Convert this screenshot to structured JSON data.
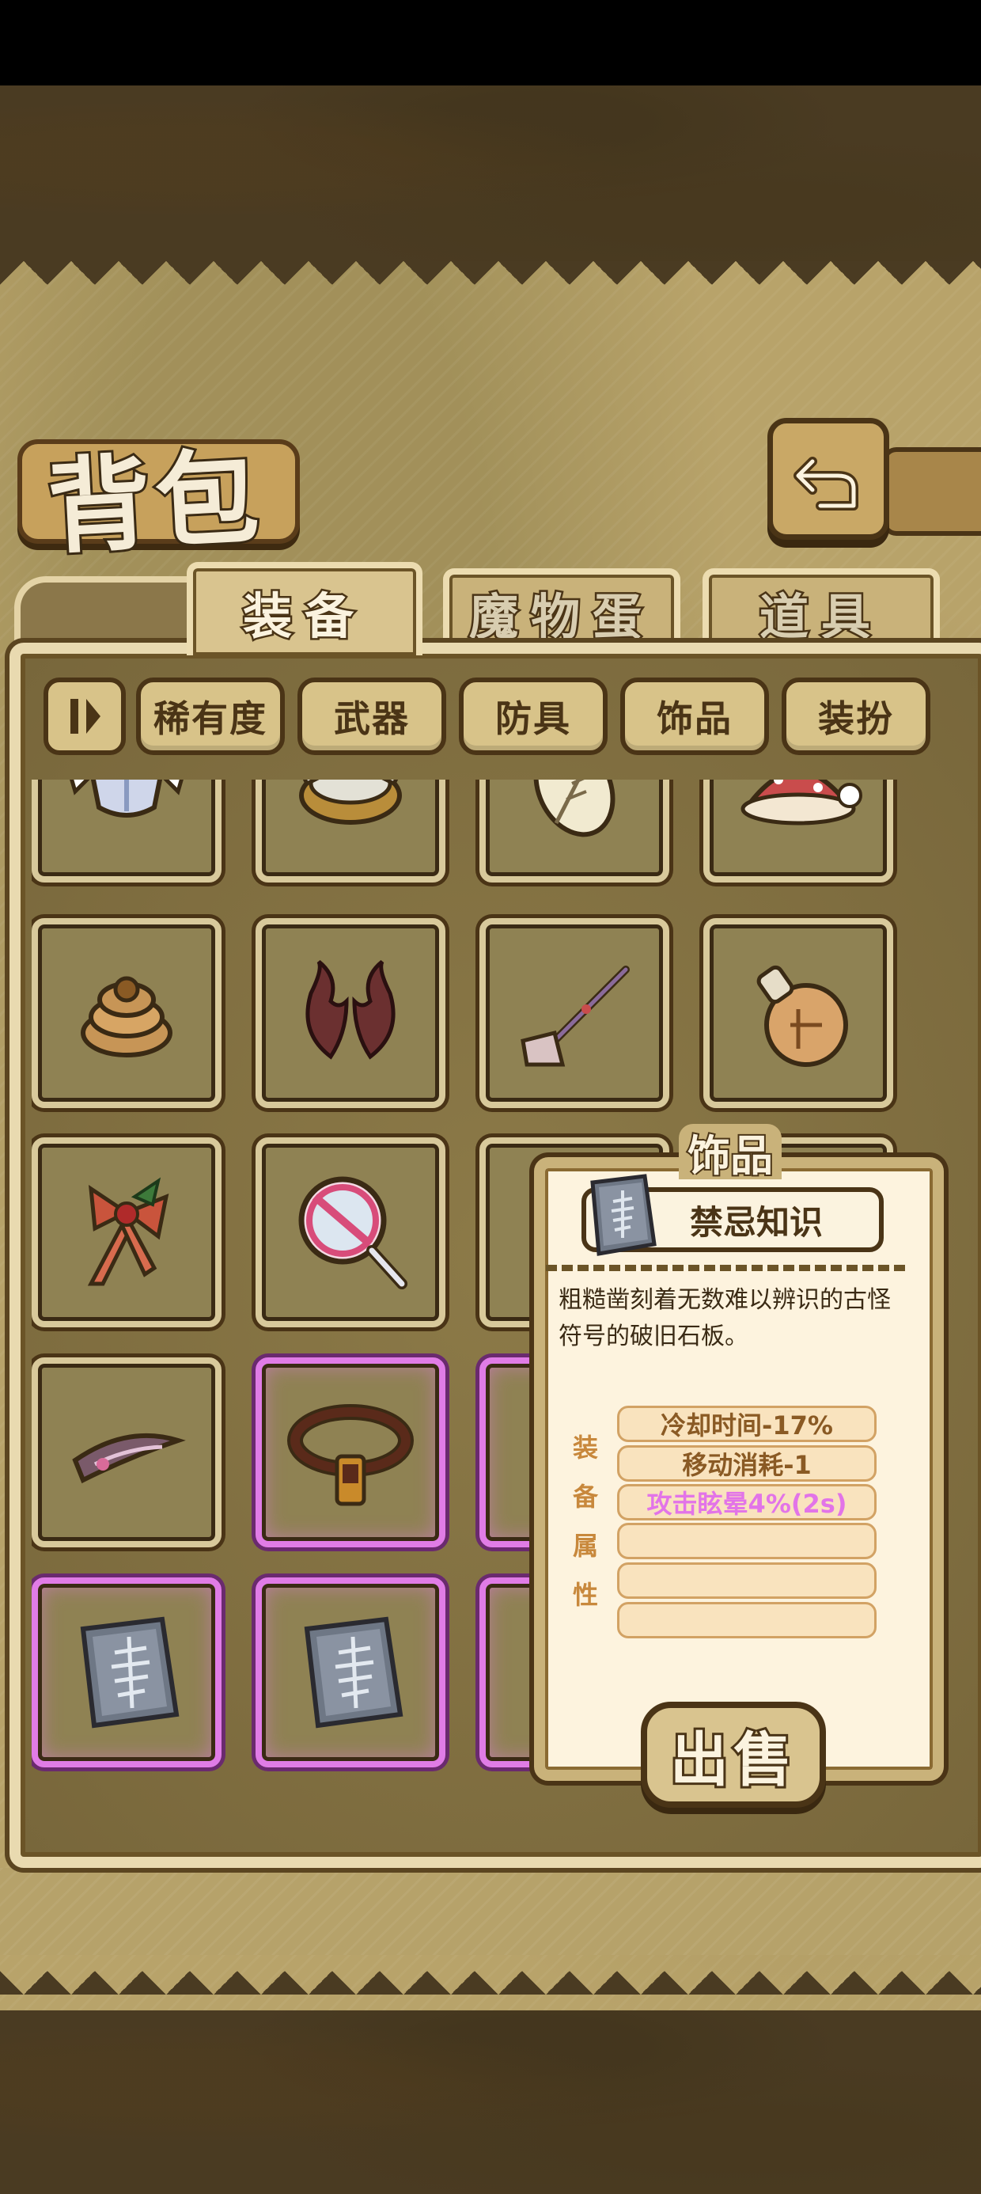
{
  "title": "背包",
  "tabs": [
    {
      "label": "装备",
      "active": true
    },
    {
      "label": "魔物蛋",
      "active": false
    },
    {
      "label": "道具",
      "active": false
    }
  ],
  "filters": [
    "稀有度",
    "武器",
    "防具",
    "饰品",
    "装扮"
  ],
  "grid": {
    "rows": [
      [
        {
          "icon": "winged-helmet-icon",
          "rarity": "common"
        },
        {
          "icon": "horned-helmet-icon",
          "rarity": "common"
        },
        {
          "icon": "leaf-badge-icon",
          "rarity": "common"
        },
        {
          "icon": "red-hat-icon",
          "rarity": "common"
        }
      ],
      [
        {
          "icon": "rope-coil-icon",
          "rarity": "common"
        },
        {
          "icon": "antlers-icon",
          "rarity": "common"
        },
        {
          "icon": "staff-shovel-icon",
          "rarity": "common"
        },
        {
          "icon": "gourd-bottle-icon",
          "rarity": "common"
        }
      ],
      [
        {
          "icon": "holly-ribbon-icon",
          "rarity": "common"
        },
        {
          "icon": "magnifier-no-icon",
          "rarity": "common"
        },
        {
          "icon": "",
          "rarity": "common"
        },
        {
          "icon": "",
          "rarity": "common"
        }
      ],
      [
        {
          "icon": "hair-clip-icon",
          "rarity": "common"
        },
        {
          "icon": "belt-icon",
          "rarity": "epic"
        },
        {
          "icon": "",
          "rarity": "epic"
        },
        {
          "icon": "",
          "rarity": "common"
        }
      ],
      [
        {
          "icon": "stone-tablet-icon",
          "rarity": "epic"
        },
        {
          "icon": "stone-tablet-icon",
          "rarity": "epic"
        },
        {
          "icon": "",
          "rarity": "epic"
        },
        {
          "icon": "",
          "rarity": "epic"
        }
      ]
    ]
  },
  "detail": {
    "category": "饰品",
    "name": "禁忌知识",
    "icon": "stone-tablet-icon",
    "description": "粗糙凿刻着无数难以辨识的古怪符号的破旧石板。",
    "attr_label": [
      "装",
      "备",
      "属",
      "性"
    ],
    "attributes": [
      {
        "text": "冷却时间-17%",
        "color": "#8a5a24"
      },
      {
        "text": "移动消耗-1",
        "color": "#8a5a24"
      },
      {
        "text": "攻击眩晕4%(2s)",
        "color": "#e274e8"
      },
      {
        "text": "",
        "color": "#8a5a24"
      },
      {
        "text": "",
        "color": "#8a5a24"
      },
      {
        "text": "",
        "color": "#8a5a24"
      }
    ],
    "sell_label": "出售"
  },
  "back_icon": "return-arrow-icon",
  "colors": {
    "epic": "#e07ce6",
    "frame": "#4a3416",
    "parchment": "#b8a36a"
  }
}
